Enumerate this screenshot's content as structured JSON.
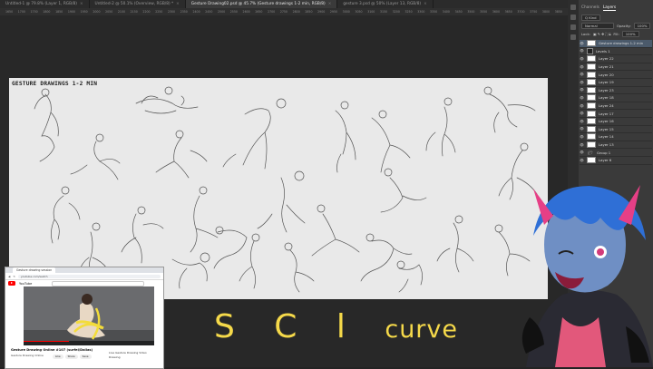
{
  "tabs": [
    {
      "label": "Untitled-1 @ 79.8% (Layer 1, RGB/8)",
      "active": false
    },
    {
      "label": "Untitled-2 @ 50.1% (Overview, RGB/8) *",
      "active": false
    },
    {
      "label": "Gesture Drawing02.psd @ 45.7% (Gesture drawings 1-2 min, RGB/8)",
      "active": true
    },
    {
      "label": "gesture 3.psd @ 50% (Layer 13, RGB/8)",
      "active": false
    }
  ],
  "ruler_numbers": [
    "1650",
    "1700",
    "1750",
    "1800",
    "1850",
    "1900",
    "1950",
    "2000",
    "2050",
    "2100",
    "2150",
    "2200",
    "2250",
    "2300",
    "2350",
    "2400",
    "2450",
    "2500",
    "2550",
    "2600",
    "2650",
    "2700",
    "2750",
    "2800",
    "2850",
    "2900",
    "2950",
    "3000",
    "3050",
    "3100",
    "3150",
    "3200",
    "3250",
    "3300",
    "3350",
    "3400",
    "3450",
    "3500",
    "3550",
    "3600",
    "3650",
    "3700",
    "3750",
    "3800",
    "3850"
  ],
  "canvas": {
    "title": "GESTURE DRAWINGS 1-2 MIN",
    "background_color": "#e9e9e9",
    "sketch_color": "#555555"
  },
  "annotation": {
    "letters": "S C l",
    "word": "curve",
    "color": "#f5d94a"
  },
  "browser": {
    "tab_label": "Gesture drawing session",
    "url": "youtube.com/watch",
    "site": "YouTube",
    "video_title": "Gesture Drawing Online #107 (surfel/Dallas)",
    "channel": "Gesture Drawing Online",
    "progress": 0.35,
    "buttons": [
      "Like",
      "Share",
      "Save"
    ],
    "side_items": [
      "Live Gesture Drawing Video",
      "Drawing"
    ]
  },
  "panel": {
    "tabs": [
      "Channels",
      "Layers"
    ],
    "active_tab": "Layers",
    "filter_label": "Q Kind",
    "blend_mode": "Normal",
    "opacity_label": "Opacity:",
    "opacity_value": "100%",
    "lock_label": "Lock:",
    "fill_label": "Fill:",
    "fill_value": "100%",
    "layers": [
      {
        "name": "Gesture drawings 1-2 min",
        "selected": true,
        "type": "layer"
      },
      {
        "name": "Levels 1",
        "selected": false,
        "type": "adjustment"
      },
      {
        "name": "Layer 22",
        "selected": false,
        "type": "layer"
      },
      {
        "name": "Layer 21",
        "selected": false,
        "type": "layer"
      },
      {
        "name": "Layer 20",
        "selected": false,
        "type": "layer"
      },
      {
        "name": "Layer 19",
        "selected": false,
        "type": "layer"
      },
      {
        "name": "Layer 23",
        "selected": false,
        "type": "layer"
      },
      {
        "name": "Layer 18",
        "selected": false,
        "type": "layer"
      },
      {
        "name": "Layer 24",
        "selected": false,
        "type": "layer"
      },
      {
        "name": "Layer 17",
        "selected": false,
        "type": "layer"
      },
      {
        "name": "Layer 16",
        "selected": false,
        "type": "layer"
      },
      {
        "name": "Layer 15",
        "selected": false,
        "type": "layer"
      },
      {
        "name": "Layer 14",
        "selected": false,
        "type": "layer"
      },
      {
        "name": "Layer 13",
        "selected": false,
        "type": "layer"
      },
      {
        "name": "Group 1",
        "selected": false,
        "type": "group"
      },
      {
        "name": "Layer 6",
        "selected": false,
        "type": "layer"
      }
    ]
  }
}
